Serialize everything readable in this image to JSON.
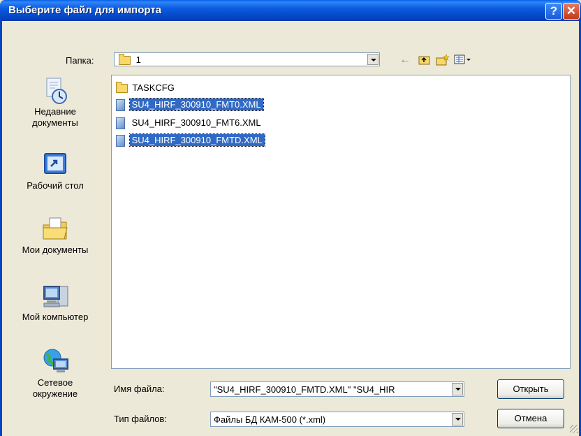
{
  "window": {
    "title": "Выберите файл для импорта"
  },
  "titlebar_buttons": {
    "help": "?",
    "close": "✕"
  },
  "lookin": {
    "label": "Папка:",
    "value": "1"
  },
  "toolbar": {
    "back_icon": "arrow-left-icon",
    "up_icon": "folder-up-icon",
    "new_folder_icon": "new-folder-icon",
    "view_menu_icon": "view-menu-icon"
  },
  "places": [
    {
      "name": "Недавние документы",
      "line1": "Недавние",
      "line2": "документы",
      "icon": "recent-documents-icon"
    },
    {
      "name": "Рабочий стол",
      "line1": "Рабочий стол",
      "line2": "",
      "icon": "desktop-icon"
    },
    {
      "name": "Мои документы",
      "line1": "Мои документы",
      "line2": "",
      "icon": "my-documents-icon"
    },
    {
      "name": "Мой компьютер",
      "line1": "Мой компьютер",
      "line2": "",
      "icon": "my-computer-icon"
    },
    {
      "name": "Сетевое окружение",
      "line1": "Сетевое",
      "line2": "окружение",
      "icon": "network-icon"
    }
  ],
  "files": [
    {
      "name": "TASKCFG",
      "type": "folder",
      "selected": false
    },
    {
      "name": "SU4_HIRF_300910_FMT0.XML",
      "type": "file",
      "selected": true
    },
    {
      "name": "SU4_HIRF_300910_FMT6.XML",
      "type": "file",
      "selected": false
    },
    {
      "name": "SU4_HIRF_300910_FMTD.XML",
      "type": "file",
      "selected": true
    }
  ],
  "filename": {
    "label": "Имя файла:",
    "value": "\"SU4_HIRF_300910_FMTD.XML\" \"SU4_HIR"
  },
  "filetype": {
    "label": "Тип файлов:",
    "value": "Файлы БД КАМ-500 (*.xml)"
  },
  "buttons": {
    "open": "Открыть",
    "cancel": "Отмена"
  },
  "colors": {
    "titlebar": "#0A5FE8",
    "dialog_bg": "#ECE9D8",
    "selection": "#316AC5"
  }
}
